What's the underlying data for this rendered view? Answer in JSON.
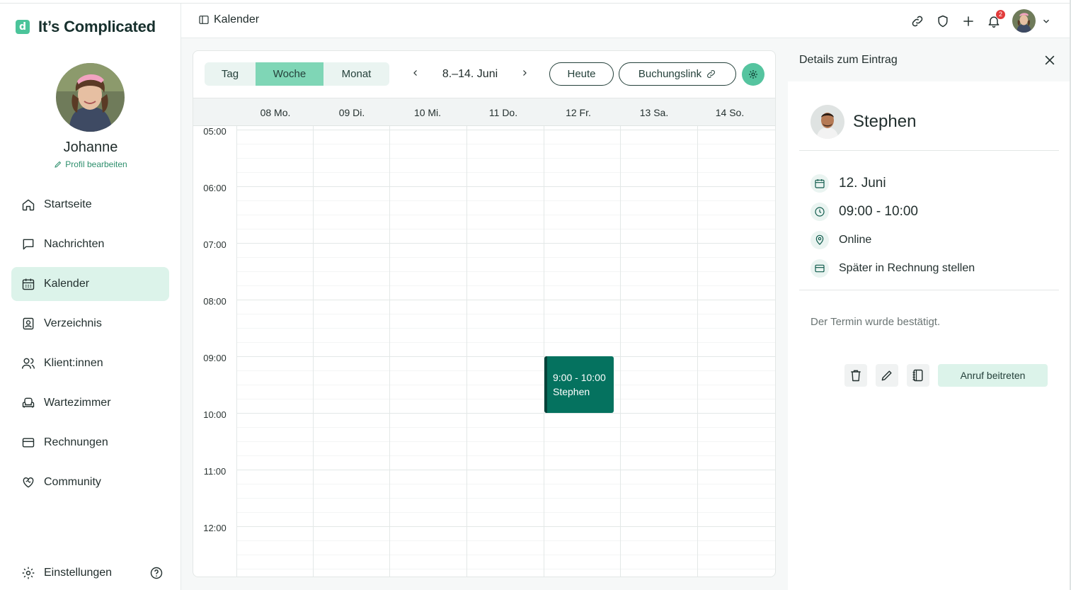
{
  "app": {
    "logo_mark": "d",
    "logo_text": "It’s Complicated",
    "accent": "#4bc49a"
  },
  "profile": {
    "name": "Johanne",
    "edit_label": "Profil bearbeiten"
  },
  "sidebar": {
    "items": [
      {
        "label": "Startseite",
        "icon": "home-icon"
      },
      {
        "label": "Nachrichten",
        "icon": "chat-icon"
      },
      {
        "label": "Kalender",
        "icon": "calendar-icon",
        "active": true
      },
      {
        "label": "Verzeichnis",
        "icon": "directory-icon"
      },
      {
        "label": "Klient:innen",
        "icon": "users-icon"
      },
      {
        "label": "Wartezimmer",
        "icon": "armchair-icon"
      },
      {
        "label": "Rechnungen",
        "icon": "credit-card-icon"
      },
      {
        "label": "Community",
        "icon": "heart-handshake-icon"
      }
    ],
    "settings_label": "Einstellungen"
  },
  "header": {
    "title": "Kalender",
    "notification_count": "2"
  },
  "calendar": {
    "views": [
      "Tag",
      "Woche",
      "Monat"
    ],
    "active_view": "Woche",
    "range_label": "8.–14. Juni",
    "today_label": "Heute",
    "booking_label": "Buchungslink",
    "days": [
      "08 Mo.",
      "09 Di.",
      "10 Mi.",
      "11 Do.",
      "12 Fr.",
      "13 Sa.",
      "14 So."
    ],
    "hours": [
      "05:00",
      "06:00",
      "07:00",
      "08:00",
      "09:00",
      "10:00",
      "11:00",
      "12:00"
    ],
    "event": {
      "time": "9:00 - 10:00",
      "name": "Stephen",
      "color": "#05725f"
    }
  },
  "details": {
    "title": "Details zum Eintrag",
    "person": "Stephen",
    "date": "12. Juni",
    "time": "09:00 - 10:00",
    "location": "Online",
    "billing": "Später in Rechnung stellen",
    "note": "Der Termin wurde bestätigt.",
    "join_label": "Anruf beitreten"
  }
}
